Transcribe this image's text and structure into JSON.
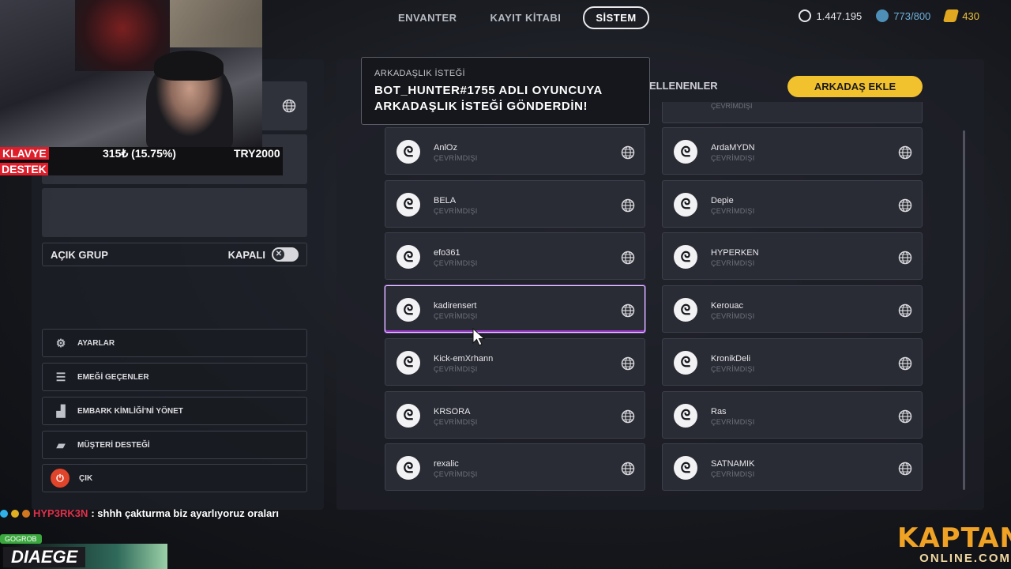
{
  "nav": {
    "tabs": [
      {
        "label": "ENVANTER"
      },
      {
        "label": "KAYIT KİTABI"
      },
      {
        "label": "SİSTEM",
        "active": true
      }
    ]
  },
  "currencies": [
    {
      "icon": "coin-icon",
      "value": "1.447.195"
    },
    {
      "icon": "credit-icon",
      "value": "773/800"
    },
    {
      "icon": "token-icon",
      "value": "430"
    }
  ],
  "left_panel": {
    "group_label": "AÇIK GRUP",
    "group_state": "KAPALI",
    "menu": [
      {
        "label": "AYARLAR",
        "icon": "gear-icon"
      },
      {
        "label": "EMEĞİ GEÇENLER",
        "icon": "credits-list-icon"
      },
      {
        "label": "EMBARK KİMLİĞİ'Nİ YÖNET",
        "icon": "id-icon"
      },
      {
        "label": "MÜŞTERİ DESTEĞİ",
        "icon": "support-icon"
      },
      {
        "label": "ÇIK",
        "icon": "power-icon"
      }
    ]
  },
  "friends_panel": {
    "blocked_tab": "ELLENENLER",
    "add_friend": "ARKADAŞ EKLE",
    "partial_status": "ÇEVRİMDIŞI",
    "left_column": [
      {
        "name": "AnlOz",
        "status": "ÇEVRİMDIŞI"
      },
      {
        "name": "BELA",
        "status": "ÇEVRİMDIŞI"
      },
      {
        "name": "efo361",
        "status": "ÇEVRİMDIŞI"
      },
      {
        "name": "kadirensert",
        "status": "ÇEVRİMDIŞI",
        "selected": true
      },
      {
        "name": "Kick-emXrhann",
        "status": "ÇEVRİMDIŞI"
      },
      {
        "name": "KRSORA",
        "status": "ÇEVRİMDIŞI"
      },
      {
        "name": "rexalic",
        "status": "ÇEVRİMDIŞI"
      }
    ],
    "right_column": [
      {
        "name": "ArdaMYDN",
        "status": "ÇEVRİMDIŞI"
      },
      {
        "name": "Depie",
        "status": "ÇEVRİMDIŞI"
      },
      {
        "name": "HYPERKEN",
        "status": "ÇEVRİMDIŞI"
      },
      {
        "name": "Kerouac",
        "status": "ÇEVRİMDIŞI"
      },
      {
        "name": "KronikDeli",
        "status": "ÇEVRİMDIŞI"
      },
      {
        "name": "Ras",
        "status": "ÇEVRİMDIŞI"
      },
      {
        "name": "SATNAMIK",
        "status": "ÇEVRİMDIŞI"
      }
    ]
  },
  "notification": {
    "title": "ARKADAŞLIK İSTEĞİ",
    "message": "BOT_HUNTER#1755 ADLI OYUNCUYA ARKADAŞLIK İSTEĞİ GÖNDERDİN!"
  },
  "stream_overlay": {
    "klavye": "KLAVYE",
    "destek": "DESTEK",
    "donation": "315₺ (15.75%)",
    "goal": "TRY2000",
    "chat_user": "HYP3RK3N",
    "chat_message": ": shhh çakturma biz ayarlıyoruz oraları",
    "tag": "GOGROB",
    "streamer": "DIAEGE",
    "brand_top": "KAPTAN",
    "brand_bottom": "ONLINE.COM"
  },
  "colors": {
    "accent_yellow": "#f2c12e",
    "exit_red": "#e0442a",
    "credit_blue": "#6fb2dc",
    "token_gold": "#f0c23a"
  }
}
